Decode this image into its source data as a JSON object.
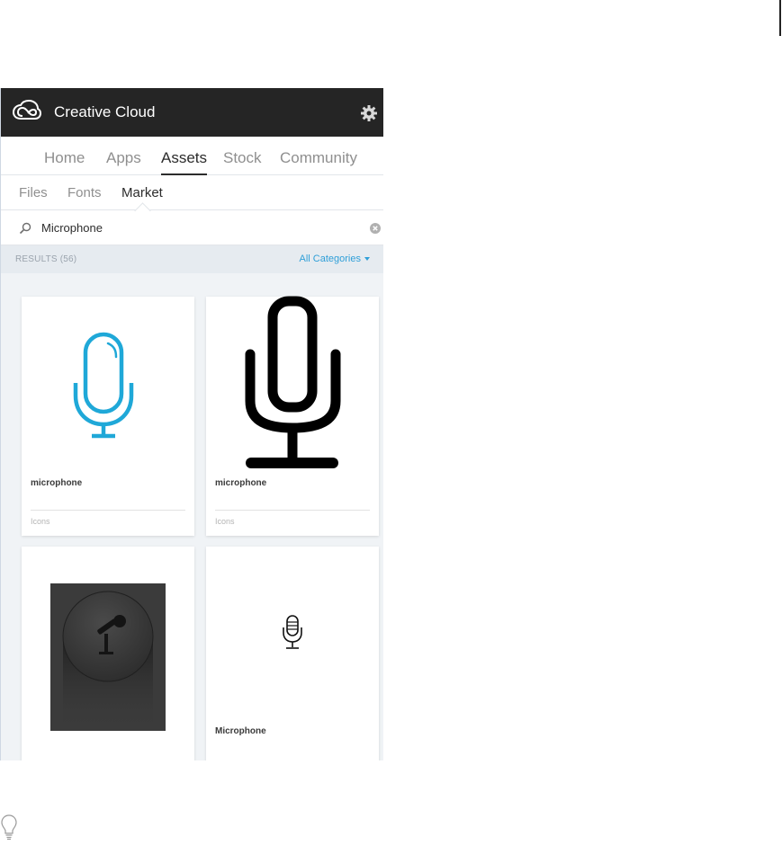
{
  "window": {
    "app_title": "Creative Cloud"
  },
  "nav_tabs": [
    {
      "label": "Home",
      "active": false
    },
    {
      "label": "Apps",
      "active": false
    },
    {
      "label": "Assets",
      "active": true
    },
    {
      "label": "Stock",
      "active": false
    },
    {
      "label": "Community",
      "active": false
    }
  ],
  "sub_tabs": [
    {
      "label": "Files",
      "active": false
    },
    {
      "label": "Fonts",
      "active": false
    },
    {
      "label": "Market",
      "active": true
    }
  ],
  "search": {
    "value": "Microphone",
    "placeholder": ""
  },
  "results": {
    "label": "RESULTS (56)",
    "category_label": "All Categories"
  },
  "cards": [
    {
      "title": "microphone",
      "tag": "Icons",
      "icon": "microphone-outline-blue-icon"
    },
    {
      "title": "microphone",
      "tag": "Icons",
      "icon": "microphone-bold-black-icon"
    },
    {
      "title": "",
      "tag": "",
      "icon": "microphone-button-dark-icon"
    },
    {
      "title": "Microphone",
      "tag": "",
      "icon": "microphone-studio-icon"
    }
  ],
  "colors": {
    "titlebar": "#252525",
    "accent": "#2f9fd8",
    "panel_bg": "#f0f3f6",
    "active_text": "#2c2c2c",
    "inactive_text": "#8f8f8f"
  },
  "icons": [
    "creative-cloud-logo-icon",
    "gear-icon",
    "search-icon",
    "clear-icon",
    "caret-down-icon",
    "lightbulb-icon"
  ]
}
